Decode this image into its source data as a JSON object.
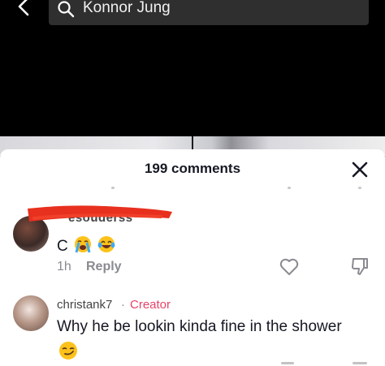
{
  "search": {
    "query": "Konnor Jung"
  },
  "comments_panel": {
    "title": "199 comments",
    "comments": [
      {
        "username_fragment": "esouderss",
        "text": "C",
        "emojis": [
          "loudly-crying-face",
          "tears-of-joy-face"
        ],
        "time": "1h",
        "reply_label": "Reply"
      },
      {
        "username": "christank7",
        "separator": "·",
        "badge": "Creator",
        "text": "Why he be lookin kinda fine in the shower",
        "emojis": [
          "smirking-face"
        ]
      }
    ]
  },
  "colors": {
    "creator_badge": "#e6436a",
    "search_box": "#2f2f2f",
    "redaction": "#e8301e"
  }
}
